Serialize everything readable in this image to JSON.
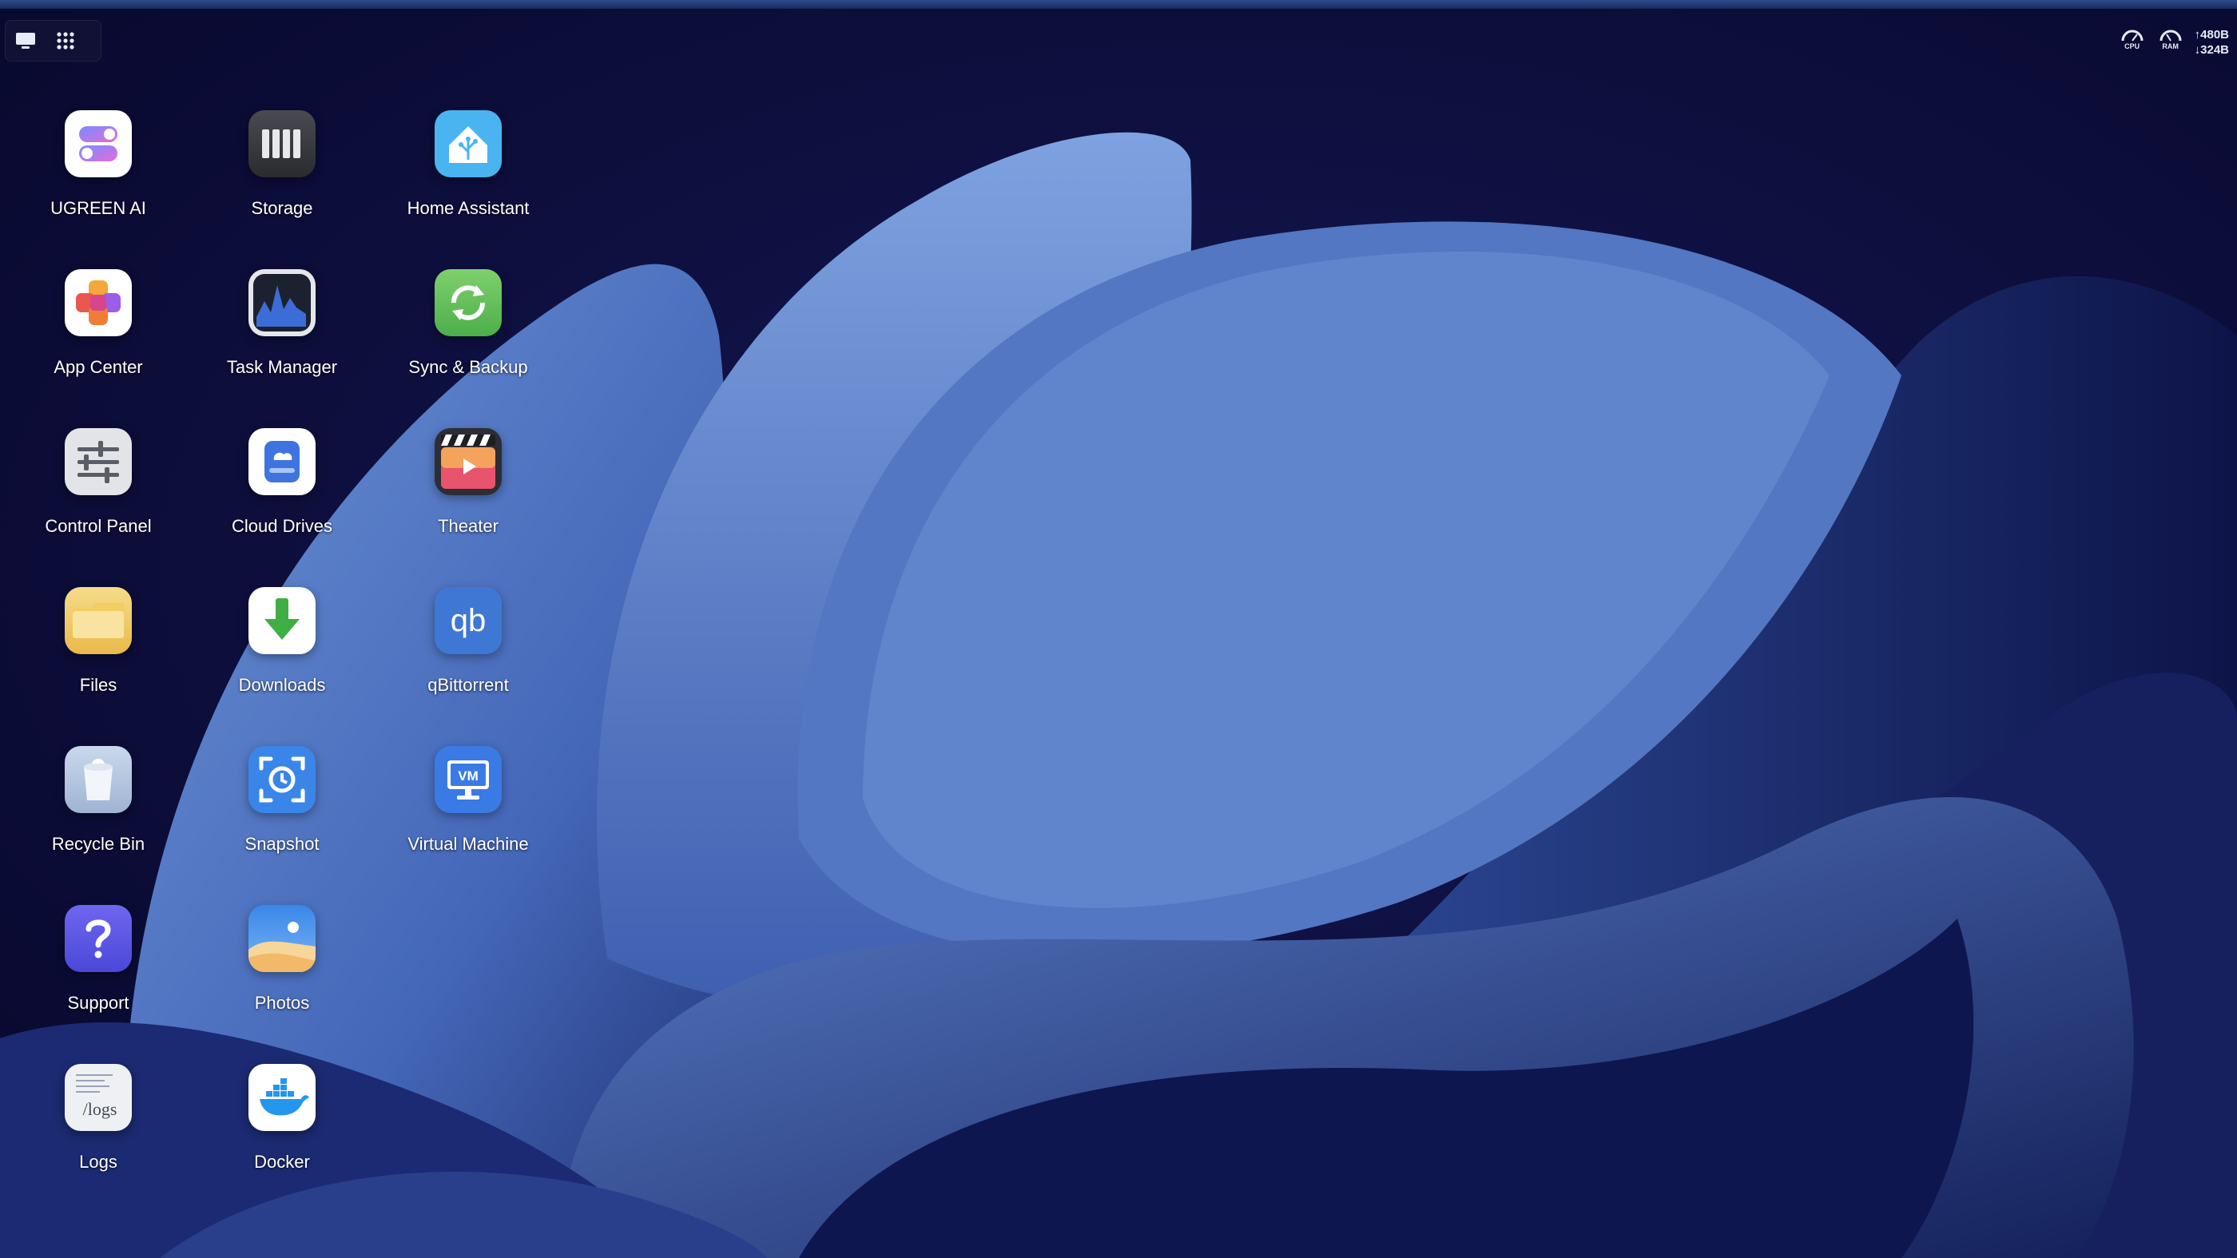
{
  "colors": {
    "background": "#0b0a2e",
    "accent": "#4f7bd0",
    "label": "#ffffff"
  },
  "toolbar": {
    "desktop_view_icon": "monitor-icon",
    "apps_view_icon": "grid-icon"
  },
  "system_monitor": {
    "cpu_label": "CPU",
    "ram_label": "RAM",
    "upload": "↑480B",
    "download": "↓324B"
  },
  "apps": [
    {
      "label": "UGREEN AI",
      "icon": "ugreen-ai-icon"
    },
    {
      "label": "App Center",
      "icon": "app-center-icon"
    },
    {
      "label": "Control Panel",
      "icon": "control-panel-icon"
    },
    {
      "label": "Files",
      "icon": "folder-icon"
    },
    {
      "label": "Recycle Bin",
      "icon": "recycle-bin-icon"
    },
    {
      "label": "Support",
      "icon": "support-icon"
    },
    {
      "label": "Logs",
      "icon": "logs-icon",
      "icon_text": "/logs"
    },
    {
      "label": "Storage",
      "icon": "storage-icon"
    },
    {
      "label": "Task Manager",
      "icon": "task-manager-icon"
    },
    {
      "label": "Cloud Drives",
      "icon": "cloud-drives-icon"
    },
    {
      "label": "Downloads",
      "icon": "downloads-icon"
    },
    {
      "label": "Snapshot",
      "icon": "snapshot-icon"
    },
    {
      "label": "Photos",
      "icon": "photos-icon"
    },
    {
      "label": "Docker",
      "icon": "docker-icon"
    },
    {
      "label": "Home Assistant",
      "icon": "home-assistant-icon"
    },
    {
      "label": "Sync & Backup",
      "icon": "sync-backup-icon"
    },
    {
      "label": "Theater",
      "icon": "theater-icon"
    },
    {
      "label": "qBittorrent",
      "icon": "qbittorrent-icon",
      "icon_text": "qb"
    },
    {
      "label": "Virtual Machine",
      "icon": "virtual-machine-icon",
      "icon_text": "VM"
    }
  ]
}
